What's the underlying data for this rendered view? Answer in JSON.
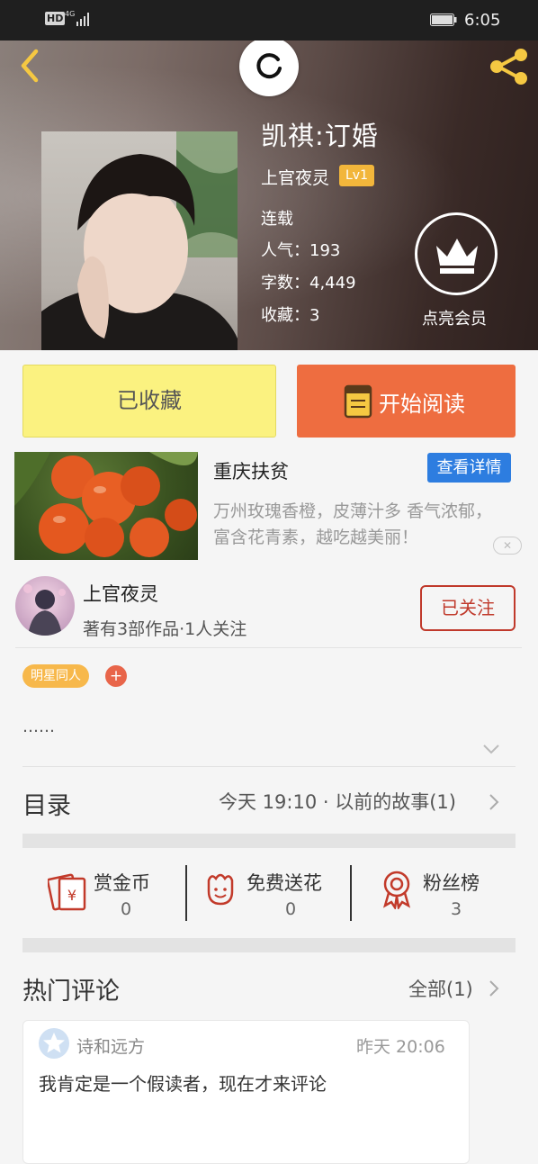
{
  "status_bar": {
    "hd": "HD",
    "network": "4G",
    "time": "6:05"
  },
  "book": {
    "title": "凯祺:订婚",
    "author": "上官夜灵",
    "level": "Lv1",
    "status": "连载",
    "popularity": "人气：193",
    "word_count": "字数：4,449",
    "favorites": "收藏：3",
    "vip_label": "点亮会员"
  },
  "actions": {
    "favorited": "已收藏",
    "start_reading": "开始阅读"
  },
  "ad": {
    "title": "重庆扶贫",
    "detail_button": "查看详情",
    "description": "万州玫瑰香橙，皮薄汁多 香气浓郁，富含花青素，越吃越美丽！",
    "close": "✕"
  },
  "author": {
    "name": "上官夜灵",
    "stats": "著有3部作品·1人关注",
    "follow": "已关注"
  },
  "tags": [
    "明星同人"
  ],
  "tag_add": "+",
  "description": "……",
  "catalog": {
    "label": "目录",
    "latest": "今天 19:10 · 以前的故事(1)"
  },
  "stats": [
    {
      "label": "赏金币",
      "value": "0",
      "icon": "coin-envelope-icon"
    },
    {
      "label": "免费送花",
      "value": "0",
      "icon": "flower-icon"
    },
    {
      "label": "粉丝榜",
      "value": "3",
      "icon": "medal-icon"
    }
  ],
  "comments": {
    "label": "热门评论",
    "all": "全部(1)",
    "items": [
      {
        "user": "诗和远方",
        "time": "昨天 20:06",
        "text": "我肯定是一个假读者，现在才来评论"
      }
    ]
  },
  "colors": {
    "accent_orange": "#ee6d40",
    "fav_yellow": "#fbf280",
    "follow_red": "#c0392b",
    "detail_blue": "#2d7de0",
    "level_gold": "#f2b63b"
  }
}
